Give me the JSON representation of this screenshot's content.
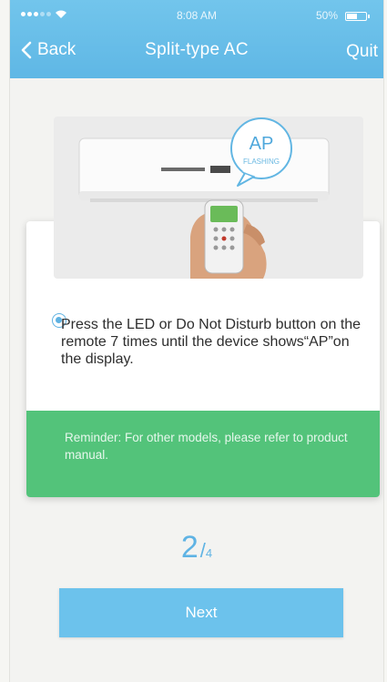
{
  "status_bar": {
    "time": "8:08 AM",
    "battery_percent": "50%",
    "battery_level": 0.5
  },
  "nav": {
    "back_label": "Back",
    "title": "Split-type AC",
    "quit_label": "Quit"
  },
  "illustration": {
    "bubble_title": "AP",
    "bubble_subtitle": "FLASHING"
  },
  "instruction": {
    "text": "Press the LED or Do Not Disturb button on the remote 7 times until the device shows“AP”on the display."
  },
  "reminder": {
    "text": "Reminder: For other models, please refer to product manual."
  },
  "progress": {
    "current": "2",
    "separator": "/",
    "total": "4"
  },
  "actions": {
    "next_label": "Next"
  },
  "colors": {
    "header": "#5fb7e5",
    "reminder": "#53c37a",
    "button": "#6cc2ec",
    "accent": "#5fb3e4"
  }
}
